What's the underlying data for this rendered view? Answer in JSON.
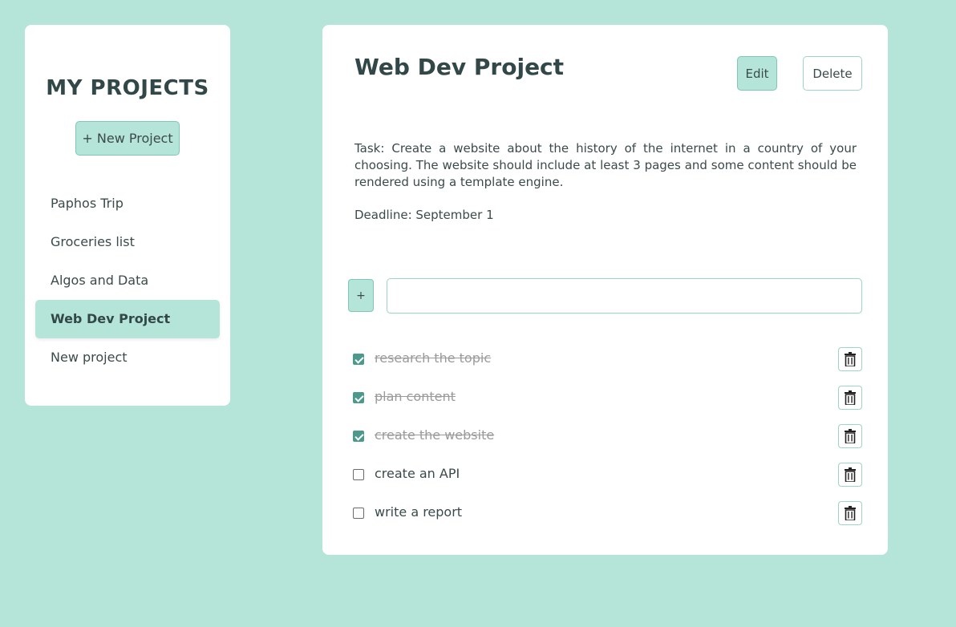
{
  "sidebar": {
    "heading": "MY PROJECTS",
    "new_project_label": "+ New Project",
    "projects": [
      {
        "label": "Paphos Trip",
        "active": false
      },
      {
        "label": "Groceries list",
        "active": false
      },
      {
        "label": "Algos and Data",
        "active": false
      },
      {
        "label": "Web Dev Project",
        "active": true
      },
      {
        "label": "New project",
        "active": false
      }
    ]
  },
  "project": {
    "title": "Web Dev Project",
    "edit_label": "Edit",
    "delete_label": "Delete",
    "description": "Task: Create a website about the history of the internet in a country of your choosing. The website should include at least 3 pages and some content should be rendered using a template engine.",
    "deadline": "Deadline: September 1",
    "add_task_label": "+",
    "task_input_value": "",
    "task_input_placeholder": "",
    "tasks": [
      {
        "label": "research the topic",
        "done": true
      },
      {
        "label": "plan content",
        "done": true
      },
      {
        "label": "create the website",
        "done": true
      },
      {
        "label": "create an API",
        "done": false
      },
      {
        "label": "write a report",
        "done": false
      }
    ]
  },
  "icons": {
    "trash": "trash-icon",
    "check": "checkmark-icon"
  },
  "colors": {
    "background": "#b5e4d9",
    "accent_border": "#7fc7b6",
    "checkbox_checked": "#4c9a8b",
    "text": "#3b4a4a"
  }
}
